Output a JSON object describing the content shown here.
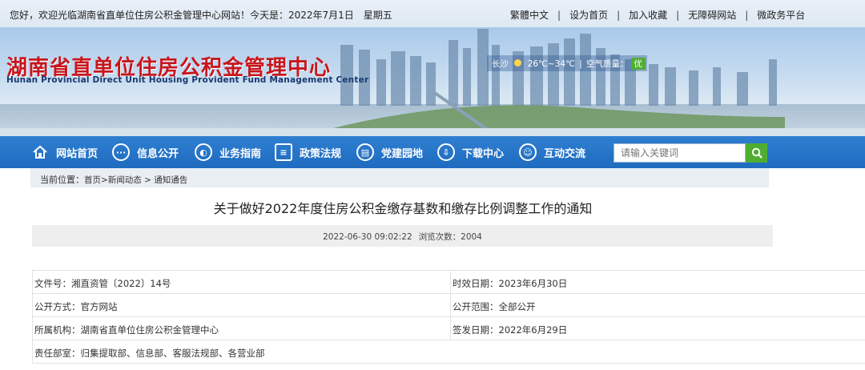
{
  "topbar": {
    "welcome": "您好，欢迎光临湖南省直单位住房公积金管理中心网站！今天是：2022年7月1日　星期五",
    "links": [
      "繁體中文",
      "设为首页",
      "加入收藏",
      "无障碍网站",
      "微政务平台"
    ]
  },
  "banner": {
    "title": "湖南省直单位住房公积金管理中心",
    "subtitle": "Hunan Provincial Direct Unit Housing Provident Fund Management Center",
    "weather": {
      "city": "长沙",
      "temp": "26℃~34℃",
      "aq_label": "空气质量：",
      "aq_value": "优"
    }
  },
  "nav": {
    "items": [
      {
        "label": "网站首页",
        "icon": "home-icon"
      },
      {
        "label": "信息公开",
        "icon": "chat-icon"
      },
      {
        "label": "业务指南",
        "icon": "compass-icon"
      },
      {
        "label": "政策法规",
        "icon": "book-icon"
      },
      {
        "label": "党建园地",
        "icon": "list-icon"
      },
      {
        "label": "下载中心",
        "icon": "download-icon"
      },
      {
        "label": "互动交流",
        "icon": "user-icon"
      }
    ],
    "search_placeholder": "请输入关键词"
  },
  "breadcrumb": {
    "label": "当前位置：",
    "path": "首页>新闻动态 > 通知通告"
  },
  "article": {
    "title": "关于做好2022年度住房公积金缴存基数和缴存比例调整工作的通知",
    "datetime": "2022-06-30 09:02:22",
    "views_label": "浏览次数：",
    "views": "2004"
  },
  "info": {
    "doc_no": "文件号：湘直资管〔2022〕14号",
    "valid_date": "时效日期：2023年6月30日",
    "publish_mode": "公开方式：官方网站",
    "publish_scope": "公开范围：全部公开",
    "org": "所属机构：湖南省直单位住房公积金管理中心",
    "issue_date": "签发日期：2022年6月29日",
    "departments": "责任部室：归集提取部、信息部、客服法规部、各营业部"
  },
  "colors": {
    "nav": "#1e6bbf",
    "title_red": "#c8161d",
    "search_green": "#4fae31"
  }
}
